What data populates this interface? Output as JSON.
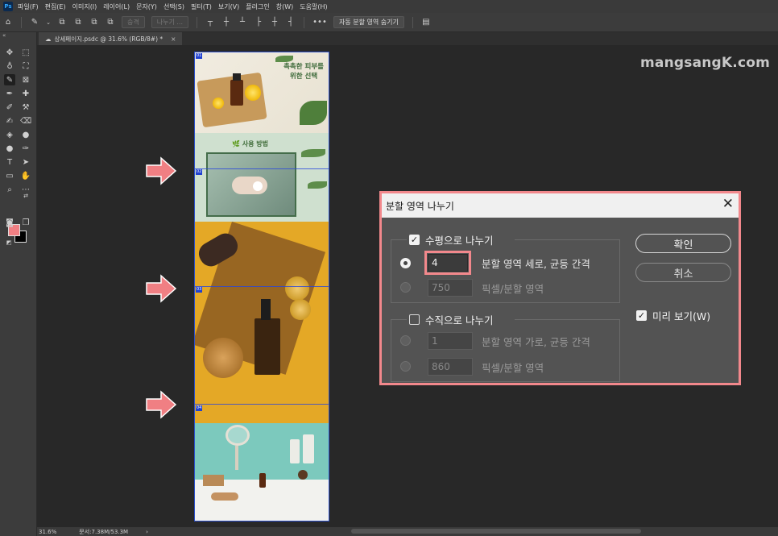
{
  "menubar": {
    "app_badge": "Ps",
    "items": [
      "파일(F)",
      "편집(E)",
      "이미지(I)",
      "레이어(L)",
      "문자(Y)",
      "선택(S)",
      "필터(T)",
      "보기(V)",
      "플러그인",
      "창(W)",
      "도움말(H)"
    ]
  },
  "options": {
    "merge_label": "승격",
    "divide_label": "나누기 ...",
    "more_label": "•••",
    "auto_slice_label": "자동 분할 영역 숨기기"
  },
  "tab": {
    "title": "상세페이지.psdc @ 31.6% (RGB/8#) *",
    "close": "×"
  },
  "watermark": "mangsangK.com",
  "doc": {
    "s1_title_line1": "촉촉한 피부를",
    "s1_title_line2": "위한 선택",
    "s2_title": "사용 방법",
    "slice_badges": [
      "01",
      "02",
      "03",
      "04"
    ]
  },
  "dialog": {
    "title": "분할 영역 나누기",
    "close": "✕",
    "horizontal_label": "수평으로 나누기",
    "horizontal_checked": "✓",
    "h_count_value": "4",
    "h_count_label": "분할 영역 세로, 균등 간격",
    "h_pixel_value": "750",
    "h_pixel_label": "픽셀/분할 영역",
    "vertical_label": "수직으로 나누기",
    "v_count_value": "1",
    "v_count_label": "분할 영역 가로, 균등 간격",
    "v_pixel_value": "860",
    "v_pixel_label": "픽셀/분할 영역",
    "ok_label": "확인",
    "cancel_label": "취소",
    "preview_label": "미리 보기(W)",
    "preview_checked": "✓"
  },
  "status": {
    "zoom": "31.6%",
    "doc_info": "문서:7.38M/53.3M",
    "arrow": "›"
  },
  "colors": {
    "foreground": "#f07f83",
    "background": "#000000",
    "highlight": "#f2888c"
  }
}
